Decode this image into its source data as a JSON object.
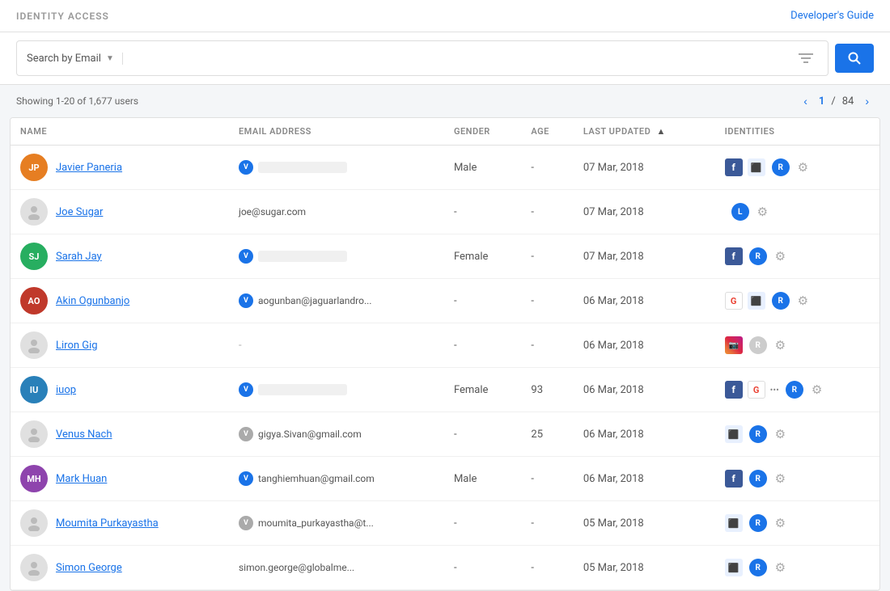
{
  "header": {
    "title": "IDENTITY ACCESS",
    "dev_guide_label": "Developer's Guide"
  },
  "search": {
    "dropdown_label": "Search by Email",
    "placeholder": "",
    "filter_icon": "⚙",
    "search_icon": "🔍"
  },
  "info": {
    "showing_text": "Showing 1-20 of 1,677 users",
    "page_current": "1",
    "page_total": "84"
  },
  "table": {
    "columns": [
      {
        "key": "name",
        "label": "NAME"
      },
      {
        "key": "email",
        "label": "EMAIL ADDRESS"
      },
      {
        "key": "gender",
        "label": "GENDER"
      },
      {
        "key": "age",
        "label": "AGE"
      },
      {
        "key": "last_updated",
        "label": "LAST UPDATED",
        "sortable": true
      },
      {
        "key": "identities",
        "label": "IDENTITIES"
      }
    ],
    "rows": [
      {
        "id": 1,
        "name": "Javier Paneria",
        "avatar_type": "image",
        "avatar_color": "#e67e22",
        "email_badge": "V",
        "email_redacted": true,
        "email_text": "",
        "gender": "Male",
        "age": "-",
        "last_updated": "07 Mar, 2018",
        "identities": [
          "fb",
          "browser"
        ],
        "role": "R",
        "role_color": "blue"
      },
      {
        "id": 2,
        "name": "Joe Sugar",
        "avatar_type": "placeholder",
        "email_badge": null,
        "email_text": "joe@sugar.com",
        "email_redacted": false,
        "gender": "-",
        "age": "-",
        "last_updated": "07 Mar, 2018",
        "identities": [],
        "role": "L",
        "role_color": "blue"
      },
      {
        "id": 3,
        "name": "Sarah Jay",
        "avatar_type": "image",
        "avatar_color": "#27ae60",
        "email_badge": "V",
        "email_redacted": true,
        "email_text": "",
        "gender": "Female",
        "age": "-",
        "last_updated": "07 Mar, 2018",
        "identities": [
          "fb"
        ],
        "role": "R",
        "role_color": "blue"
      },
      {
        "id": 4,
        "name": "Akin Ogunbanjo",
        "avatar_type": "image",
        "avatar_color": "#c0392b",
        "email_badge": "V",
        "email_text": "aogunban@jaguarlandro...",
        "email_redacted": false,
        "gender": "-",
        "age": "-",
        "last_updated": "06 Mar, 2018",
        "identities": [
          "google",
          "browser"
        ],
        "role": "R",
        "role_color": "blue"
      },
      {
        "id": 5,
        "name": "Liron Gig",
        "avatar_type": "placeholder",
        "email_badge": null,
        "email_text": "-",
        "email_redacted": false,
        "gender": "-",
        "age": "-",
        "last_updated": "06 Mar, 2018",
        "identities": [
          "instagram"
        ],
        "role": "R",
        "role_color": "gray"
      },
      {
        "id": 6,
        "name": "iuop",
        "avatar_type": "image",
        "avatar_color": "#2980b9",
        "email_badge": "V",
        "email_redacted": true,
        "email_text": "",
        "gender": "Female",
        "age": "93",
        "last_updated": "06 Mar, 2018",
        "identities": [
          "fb",
          "google",
          "more"
        ],
        "role": "R",
        "role_color": "blue"
      },
      {
        "id": 7,
        "name": "Venus Nach",
        "avatar_type": "placeholder",
        "email_badge": "V",
        "email_badge_color": "gray",
        "email_text": "gigya.Sivan@gmail.com",
        "email_redacted": false,
        "gender": "-",
        "age": "25",
        "last_updated": "06 Mar, 2018",
        "identities": [
          "browser"
        ],
        "role": "R",
        "role_color": "blue"
      },
      {
        "id": 8,
        "name": "Mark Huan",
        "avatar_type": "image",
        "avatar_color": "#8e44ad",
        "email_badge": "V",
        "email_text": "tanghiemhuan@gmail.com",
        "email_redacted": false,
        "gender": "Male",
        "age": "-",
        "last_updated": "06 Mar, 2018",
        "identities": [
          "fb"
        ],
        "role": "R",
        "role_color": "blue"
      },
      {
        "id": 9,
        "name": "Moumita Purkayastha",
        "avatar_type": "placeholder",
        "email_badge": "V",
        "email_badge_color": "gray",
        "email_text": "moumita_purkayastha@t...",
        "email_redacted": false,
        "gender": "-",
        "age": "-",
        "last_updated": "05 Mar, 2018",
        "identities": [
          "browser"
        ],
        "role": "R",
        "role_color": "blue"
      },
      {
        "id": 10,
        "name": "Simon George",
        "avatar_type": "placeholder",
        "email_badge": null,
        "email_text": "simon.george@globalme...",
        "email_redacted": false,
        "gender": "-",
        "age": "-",
        "last_updated": "05 Mar, 2018",
        "identities": [
          "browser"
        ],
        "role": "R",
        "role_color": "blue"
      }
    ]
  }
}
